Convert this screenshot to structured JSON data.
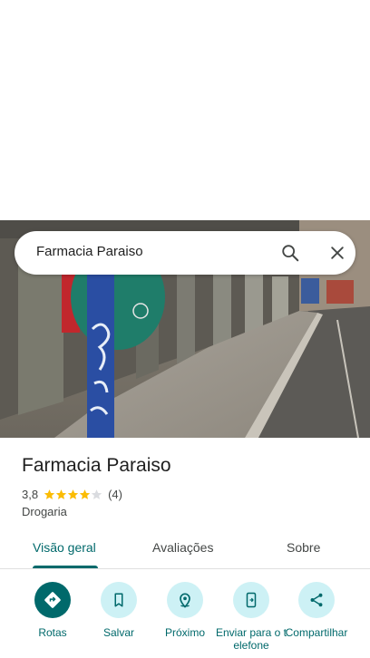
{
  "search": {
    "query": "Farmacia Paraiso"
  },
  "place": {
    "name": "Farmacia Paraiso",
    "rating": "3,8",
    "rating_stars": 3.8,
    "review_count": "(4)",
    "category": "Drogaria"
  },
  "tabs": [
    {
      "label": "Visão geral",
      "active": true
    },
    {
      "label": "Avaliações",
      "active": false
    },
    {
      "label": "Sobre",
      "active": false
    }
  ],
  "actions": [
    {
      "label": "Rotas",
      "icon": "directions-icon"
    },
    {
      "label": "Salvar",
      "icon": "bookmark-icon"
    },
    {
      "label": "Próximo",
      "icon": "nearby-icon"
    },
    {
      "label": "Enviar para o telefone",
      "icon": "send-to-phone-icon"
    },
    {
      "label": "Compartilhar",
      "icon": "share-icon"
    }
  ],
  "colors": {
    "accent": "#00696b",
    "action_bg": "#cdf1f5",
    "star": "#fbbc04",
    "star_empty": "#dadce0"
  }
}
